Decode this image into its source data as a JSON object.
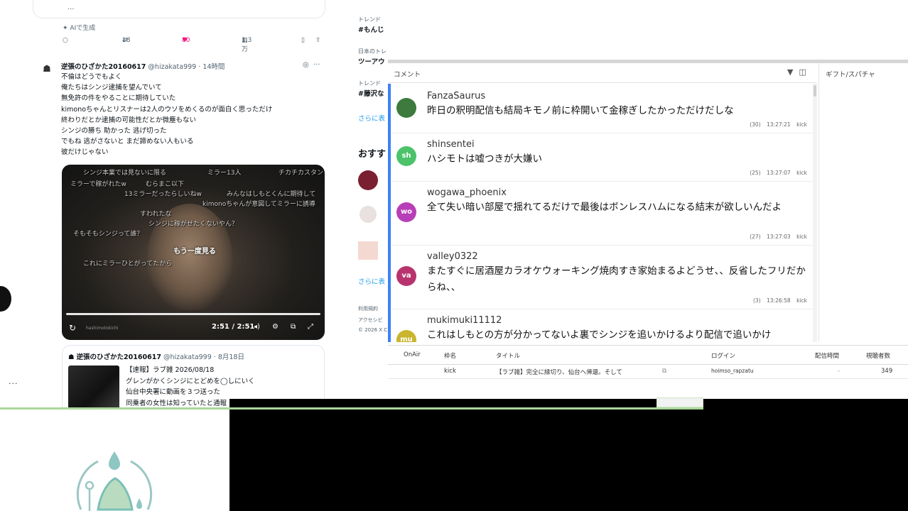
{
  "timeline": {
    "prev_ellipsis": "...",
    "ai_note": "AIで生成",
    "actions": {
      "reply": "○",
      "retweets": "18",
      "likes": "80",
      "views": "1.3万"
    },
    "post": {
      "author": "逆張のひざかた20160617",
      "handle": "@hizakata999",
      "time": "14時間",
      "lines": [
        "不倫はどうでもよく",
        "俺たちはシンジ逮捕を望んでいて",
        "無免許の件をやることに期待していた",
        "kimonoちゃんとリスナーは2人のウソをめくるのが面白く思っただけ",
        "終わりだとか逮捕の可能性だとか微塵もない",
        "シンジの勝ち 助かった 逃げ切った",
        "でもね 逃がさないと まだ諦めない人もいる",
        "彼だけじゃない"
      ]
    },
    "video": {
      "comments": [
        "シンジ本業では見ないに限る",
        "ミラー13人",
        "チカチカスタン",
        "ミラーで稼がれたw",
        "むらまこ以下",
        "13ミラーだったらしいねw",
        "みんなはしもとくんに期待して",
        "kimonoちゃんが意図してミラーに誘導",
        "すわれたな",
        "シンジに稼がせたくないやん？",
        "そもそもシンジって誰？",
        "これにミラーひとがってたから",
        "もう一度見る"
      ],
      "time": "2:51 / 2:51",
      "watermark": "hashimotokichi"
    },
    "quote": {
      "author": "逆張のひざかた20160617",
      "handle": "@hizakata999",
      "date": "8月18日",
      "lines": [
        "【速報】ラブ雑 2026/08/18",
        "グレンがかくシンジにとどめを◯しにいく",
        "仙台中央署に動画を３つ送った",
        "同乗者の女性は知っていたと通報"
      ]
    },
    "more": "..."
  },
  "sidebar": {
    "items": [
      {
        "label": "トレンド",
        "tag": "#もんじ"
      },
      {
        "label": "日本のトレ",
        "tag": "ツーアウ"
      },
      {
        "label": "トレンド",
        "tag": "#藤沢な"
      }
    ],
    "show_more": "さらに表",
    "recommend": "おすす",
    "show_more2": "さらに表",
    "footer1": "利用規約",
    "footer2": "アクセシビ",
    "footer3": "© 2026 X C"
  },
  "viewer": {
    "comment_header": "コメント",
    "gift_header": "ギフト/スパチャ",
    "comments": [
      {
        "user": "FanzaSaurus",
        "avatar": "",
        "avatar_color": "#3d7a3d",
        "text": "昨日の釈明配信も結局キモノ前に枠開いて金稼ぎしたかっただけだしな",
        "count": "(30)",
        "time": "13:27:21",
        "platform": "kick"
      },
      {
        "user": "shinsentei",
        "avatar": "sh",
        "avatar_color": "#4cc36a",
        "text": "ハシモトは嘘つきが大嫌い",
        "count": "(25)",
        "time": "13:27:07",
        "platform": "kick"
      },
      {
        "user": "wogawa_phoenix",
        "avatar": "wo",
        "avatar_color": "#b73fb7",
        "text": "全て失い暗い部屋で揺れてるだけで最後はボンレスハムになる結末が欲しいんだよ",
        "count": "(27)",
        "time": "13:27:03",
        "platform": "kick"
      },
      {
        "user": "valley0322",
        "avatar": "va",
        "avatar_color": "#b8336e",
        "text": "またすぐに居酒屋カラオケウォーキング焼肉すき家始まるよどうせ、、反省したフリだからね、、",
        "count": "(3)",
        "time": "13:26:58",
        "platform": "kick"
      },
      {
        "user": "mukimuki11112",
        "avatar": "mu",
        "avatar_color": "#c9b52e",
        "text": "これはしもとの方が分かってないよ裏でシンジを追いかけるより配信で追いかけ",
        "count": "",
        "time": "",
        "platform": ""
      }
    ]
  },
  "stream_table": {
    "headers": [
      "OnAir",
      "枠名",
      "タイトル",
      "ログイン",
      "配信時間",
      "視聴者数"
    ],
    "row": {
      "platform": "kick",
      "title": "【ラブ雑】完全に縁切り、仙台へ帰還。そして",
      "login": "hoimso_rapzatu",
      "duration": "-",
      "viewers": "349"
    }
  },
  "colors": {
    "accent_blue": "#3b82f6",
    "like_pink": "#f91880",
    "link_blue": "#1d9bf0"
  }
}
